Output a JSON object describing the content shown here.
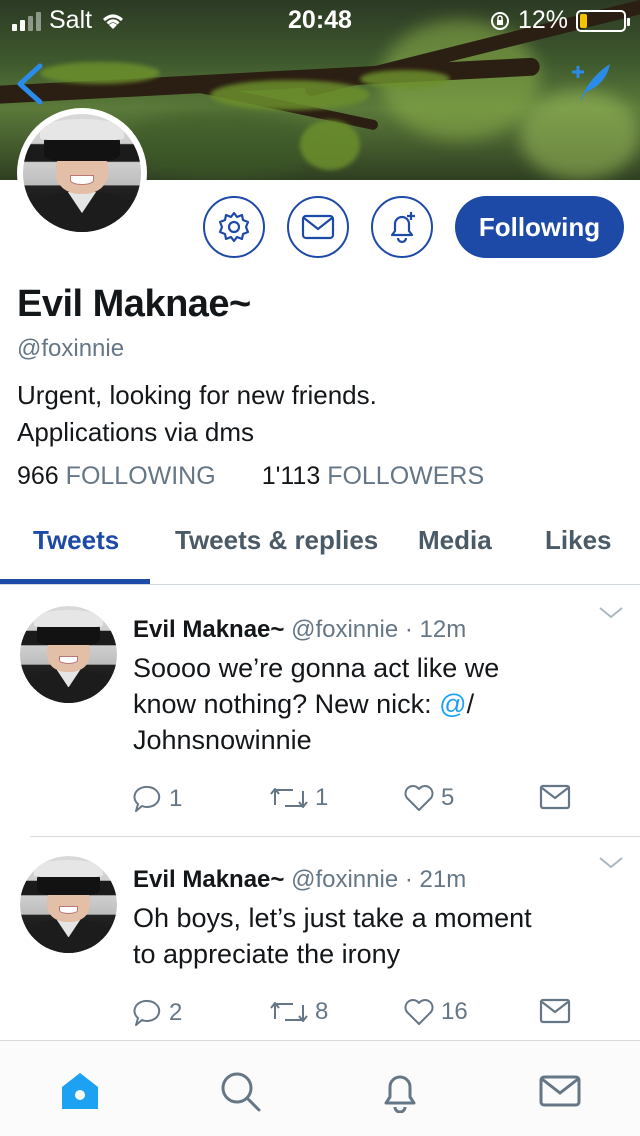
{
  "status_bar": {
    "carrier": "Salt",
    "time": "20:48",
    "battery": "12%",
    "battery_level": 0.12
  },
  "colors": {
    "brand_blue": "#1d4aa6",
    "link_blue": "#1da1f2",
    "muted_gray": "#657786",
    "battery_yellow": "#f5c400"
  },
  "profile": {
    "name": "Evil Maknae~",
    "handle": "@foxinnie",
    "bio_line1": "Urgent, looking for new friends.",
    "bio_line2": "Applications via dms",
    "following_count": "966",
    "following_label": "FOLLOWING",
    "followers_count": "1'113",
    "followers_label": "FOLLOWERS",
    "follow_button_label": "Following"
  },
  "tabs": [
    {
      "label": "Tweets",
      "active": true
    },
    {
      "label": "Tweets & replies",
      "active": false
    },
    {
      "label": "Media",
      "active": false
    },
    {
      "label": "Likes",
      "active": false
    }
  ],
  "tweets": [
    {
      "name": "Evil Maknae~",
      "handle": "@foxinnie",
      "time": "· 12m",
      "text_line1": "Soooo we’re gonna act like we",
      "text_line2_pre": "know nothing? New nick: ",
      "text_line2_mention": "@",
      "text_line2_post": "/",
      "text_line3": "Johnsnowinnie",
      "replies": "1",
      "retweets": "1",
      "likes": "5"
    },
    {
      "name": "Evil Maknae~",
      "handle": "@foxinnie",
      "time": "· 21m",
      "text_line1": "Oh boys, let’s just take a moment",
      "text_line2": "to appreciate the irony",
      "replies": "2",
      "retweets": "8",
      "likes": "16"
    }
  ],
  "icons": {
    "back": "chevron-left-icon",
    "compose": "compose-feather-icon",
    "settings": "gear-icon",
    "message": "envelope-icon",
    "notify": "bell-plus-icon",
    "home": "home-icon",
    "search": "search-icon",
    "notifications": "bell-icon",
    "messages": "envelope-icon"
  }
}
